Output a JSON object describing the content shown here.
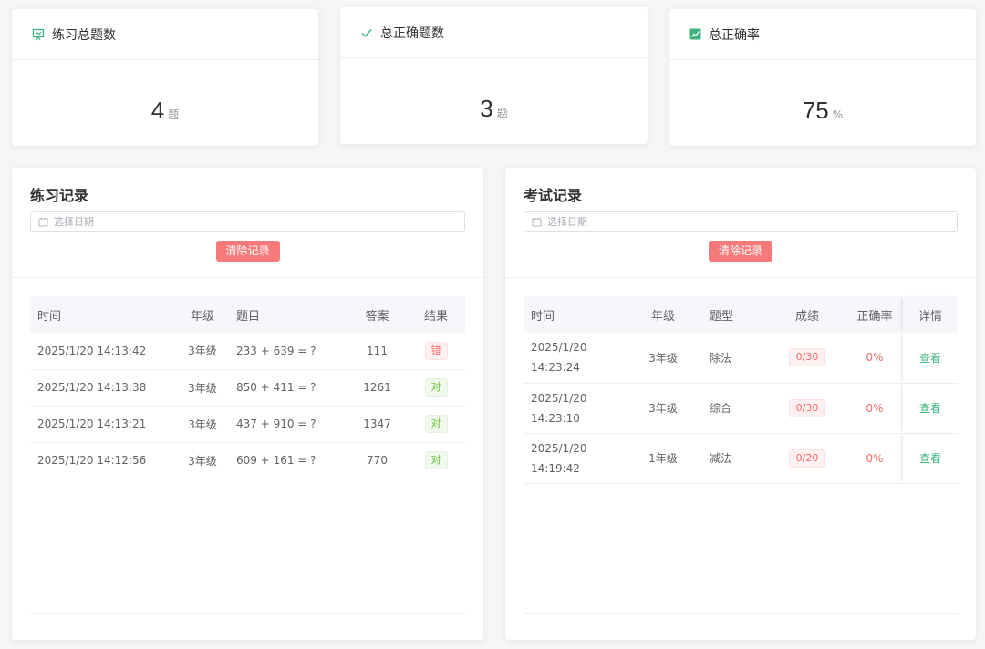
{
  "stats": [
    {
      "label": "练习总题数",
      "value": "4",
      "unit": "题",
      "icon": "presentation-chart-icon"
    },
    {
      "label": "总正确题数",
      "value": "3",
      "unit": "题",
      "icon": "check-icon"
    },
    {
      "label": "总正确率",
      "value": "75",
      "unit": "%",
      "icon": "trend-chart-icon"
    }
  ],
  "colors": {
    "accent": "#3fb27f",
    "danger": "#f67a7a",
    "wrong": "#f56c6c",
    "right": "#67c23a"
  },
  "practice": {
    "title": "练习记录",
    "date_placeholder": "选择日期",
    "clear_label": "清除记录",
    "columns": [
      "时间",
      "年级",
      "题目",
      "答案",
      "结果"
    ],
    "rows": [
      {
        "time": "2025/1/20 14:13:42",
        "grade": "3年级",
        "question": "233 + 639 = ?",
        "answer": "111",
        "result": "错"
      },
      {
        "time": "2025/1/20 14:13:38",
        "grade": "3年级",
        "question": "850 + 411 = ?",
        "answer": "1261",
        "result": "对"
      },
      {
        "time": "2025/1/20 14:13:21",
        "grade": "3年级",
        "question": "437 + 910 = ?",
        "answer": "1347",
        "result": "对"
      },
      {
        "time": "2025/1/20 14:12:56",
        "grade": "3年级",
        "question": "609 + 161 = ?",
        "answer": "770",
        "result": "对"
      }
    ]
  },
  "exam": {
    "title": "考试记录",
    "date_placeholder": "选择日期",
    "clear_label": "清除记录",
    "columns": [
      "时间",
      "年级",
      "题型",
      "成绩",
      "正确率",
      "详情"
    ],
    "rows": [
      {
        "date": "2025/1/20",
        "clock": "14:23:24",
        "grade": "3年级",
        "type": "除法",
        "score": "0/30",
        "accuracy": "0%",
        "detail": "查看"
      },
      {
        "date": "2025/1/20",
        "clock": "14:23:10",
        "grade": "3年级",
        "type": "综合",
        "score": "0/30",
        "accuracy": "0%",
        "detail": "查看"
      },
      {
        "date": "2025/1/20",
        "clock": "14:19:42",
        "grade": "1年级",
        "type": "减法",
        "score": "0/20",
        "accuracy": "0%",
        "detail": "查看"
      }
    ]
  }
}
